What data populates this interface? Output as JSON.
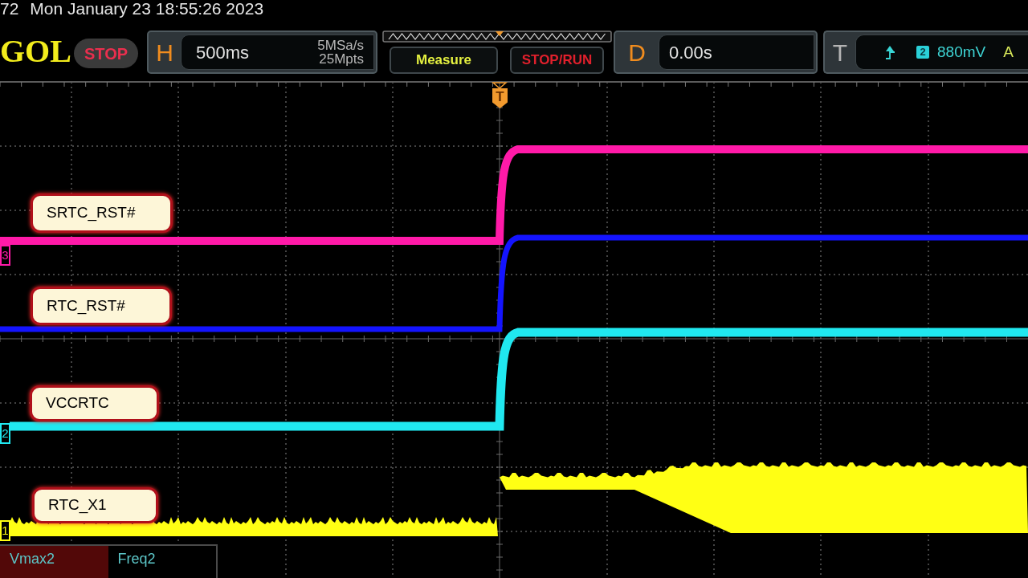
{
  "status_line": {
    "fragment": "72",
    "datetime": "Mon January 23 18:55:26 2023"
  },
  "toolbar": {
    "logo": "GOL",
    "run_state": "STOP",
    "horizontal": {
      "key": "H",
      "timebase": "500ms",
      "sample_rate": "5MSa/s",
      "memory_depth": "25Mpts"
    },
    "buttons": [
      {
        "label": "Measure",
        "kind": "measure"
      },
      {
        "label": "STOP/RUN",
        "kind": "run"
      }
    ],
    "delay": {
      "key": "D",
      "value": "0.00s"
    },
    "trigger": {
      "key": "T",
      "source": "2",
      "trigger_level": "880mV",
      "mode": "A"
    }
  },
  "display": {
    "trigger_marker": "T",
    "channels": [
      {
        "label": "SRTC_RST#",
        "marker": "3",
        "kind": "step",
        "color": "#ff1aa8"
      },
      {
        "label": "RTC_RST#",
        "kind": "step",
        "color": "#1414ff"
      },
      {
        "label": "VCCRTC",
        "marker": "2",
        "kind": "step",
        "color": "#20e8f0"
      },
      {
        "label": "RTC_X1",
        "marker": "1",
        "kind": "oscillator",
        "color": "#ffff14"
      }
    ],
    "measurements": [
      {
        "name": "Vmax2",
        "selected": true
      },
      {
        "name": "Freq2",
        "selected": false
      }
    ]
  }
}
